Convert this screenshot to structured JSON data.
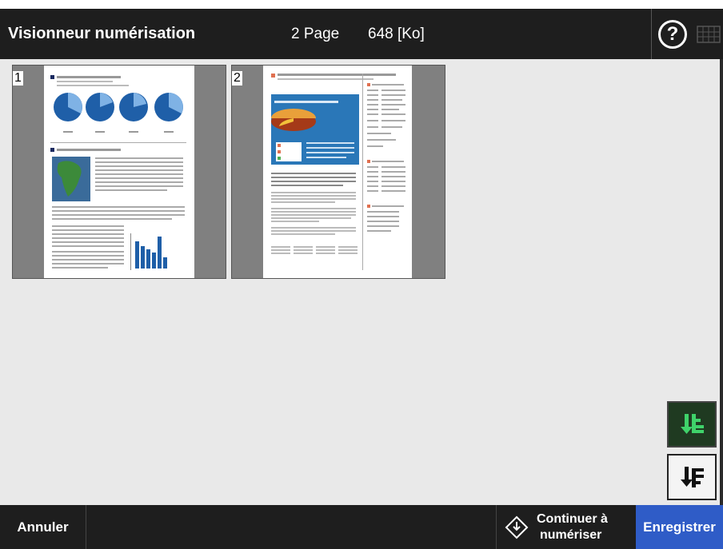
{
  "header": {
    "title": "Visionneur numérisation",
    "page_count": "2 Page",
    "file_size": "648 [Ko]"
  },
  "thumbnails": [
    {
      "number": "1"
    },
    {
      "number": "2"
    }
  ],
  "footer": {
    "cancel_label": "Annuler",
    "continue_label_line1": "Continuer à",
    "continue_label_line2": "numériser",
    "save_label": "Enregistrer"
  },
  "icons": {
    "help": "help-icon",
    "keyboard": "keyboard-icon",
    "insert": "insert-page-icon",
    "append": "append-page-icon",
    "continue": "scan-diamond-icon"
  },
  "colors": {
    "header_bg": "#1e1e1e",
    "content_bg": "#e9e9e9",
    "save_bg": "#2f5cc7",
    "active_btn_bg": "#1f3a21",
    "active_icon": "#3fd26a",
    "chart_blue": "#1f5fa8"
  }
}
